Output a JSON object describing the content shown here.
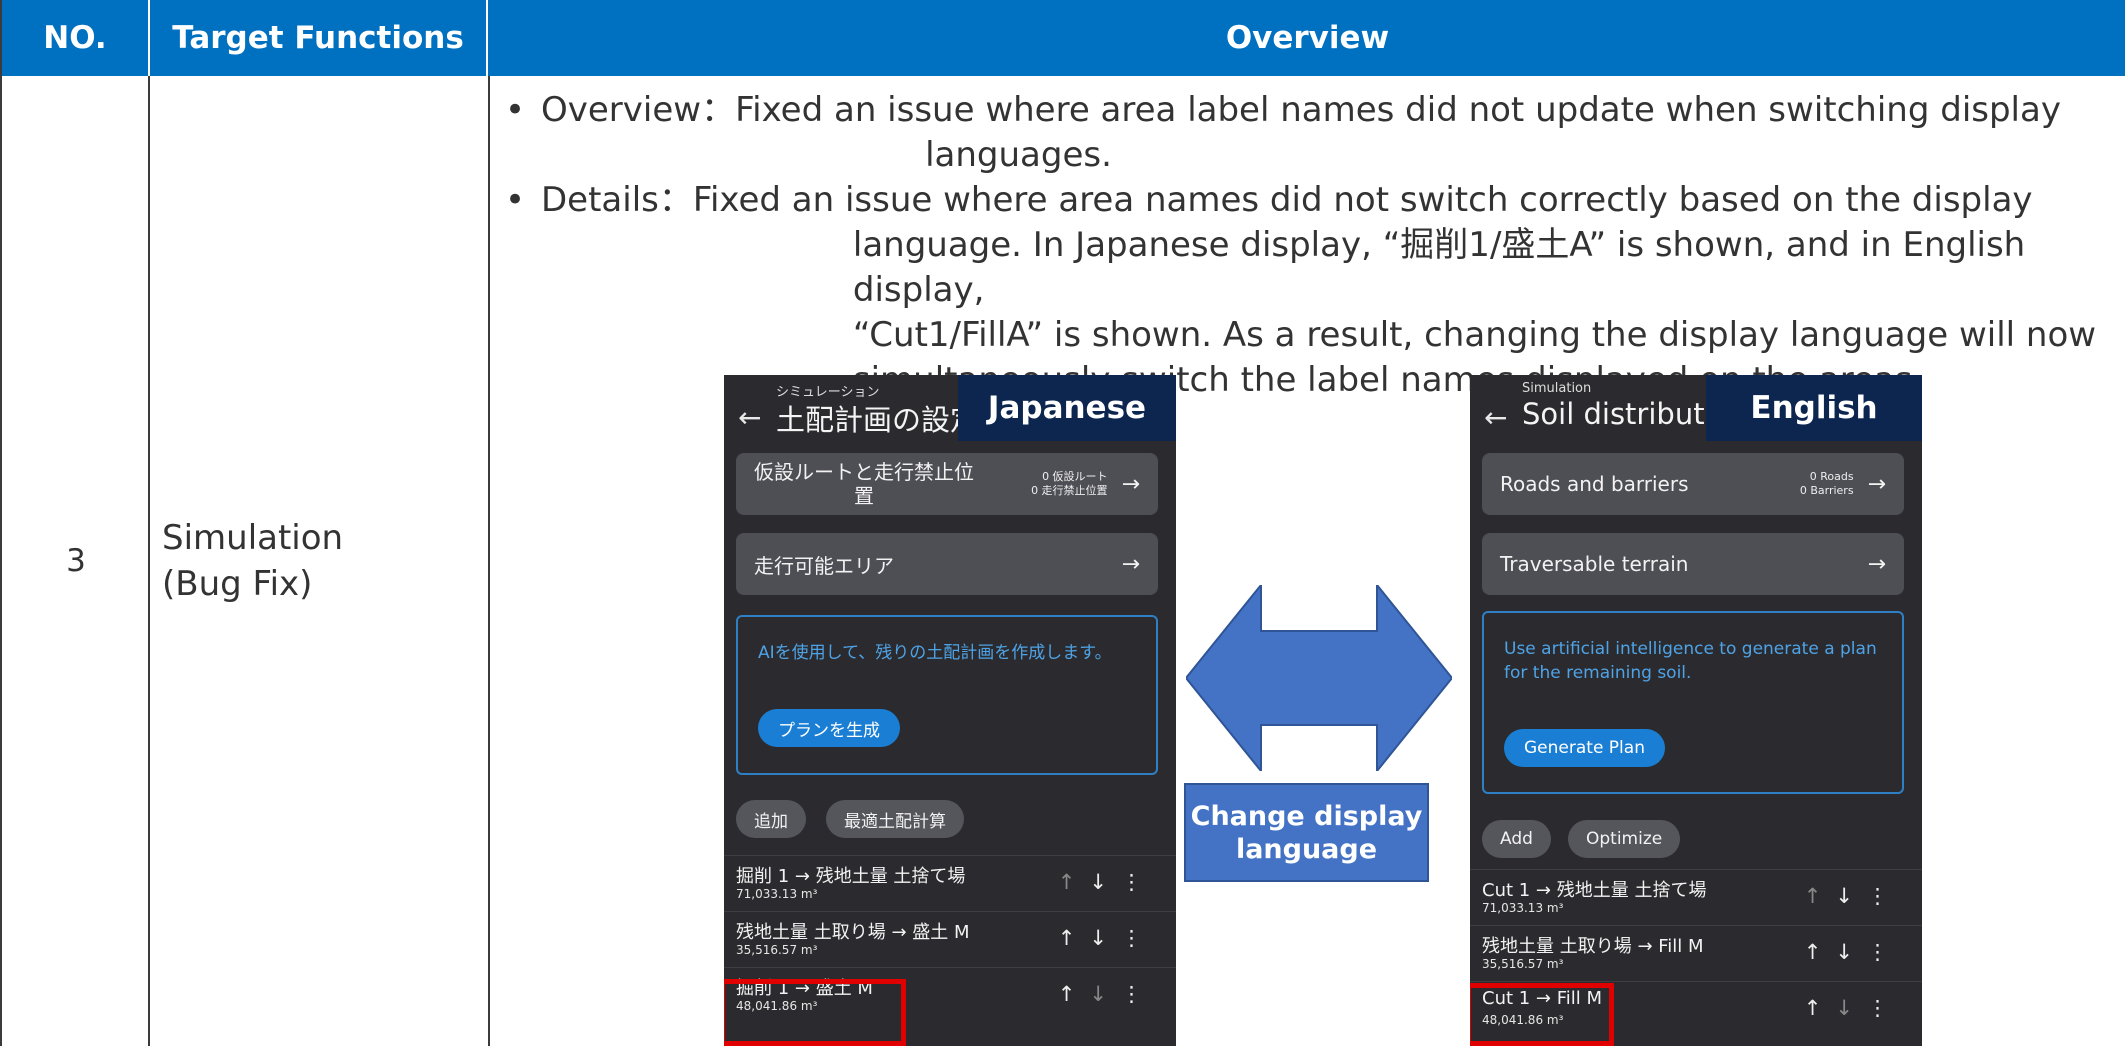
{
  "header": {
    "no": "NO.",
    "target_functions": "Target Functions",
    "overview": "Overview"
  },
  "row": {
    "no": "3",
    "target_function_line1": "Simulation",
    "target_function_line2": "(Bug Fix)",
    "bullet": "•",
    "overview_label": "Overview：",
    "overview_line1": "Fixed an issue where area label names did not update when switching display",
    "overview_line2": "languages.",
    "details_label": "Details：",
    "details_line1": "Fixed an issue where area names did not switch correctly based on the display",
    "details_line2": "language. In Japanese display, “掘削1/盛土A” is shown, and in English display,",
    "details_line3": "“Cut1/FillA” is shown. As a result, changing the display language will now",
    "details_line4": "simultaneously switch the label names displayed on the areas."
  },
  "change_label_line1": "Change display",
  "change_label_line2": "language",
  "phone_jp": {
    "badge": "Japanese",
    "back": "←",
    "subtitle": "シミュレーション",
    "title": "土配計画の設定",
    "card1_label_line1": "仮設ルートと走行禁止位",
    "card1_label_line2": "置",
    "card1_meta1": "0 仮設ルート",
    "card1_meta2": "0 走行禁止位置",
    "card2_label": "走行可能エリア",
    "arrow": "→",
    "ai_text": "AIを使用して、残りの土配計画を作成します。",
    "generate": "プランを生成",
    "chip_add": "追加",
    "chip_opt": "最適土配計算",
    "items": [
      {
        "main": "掘削 1 → 残地土量 土捨て場",
        "sub": "71,033.13 m³"
      },
      {
        "main": "残地土量 土取り場 → 盛土 M",
        "sub": "35,516.57 m³"
      },
      {
        "main": "掘削 1 → 盛土 M",
        "sub": "48,041.86 m³"
      }
    ],
    "up": "↑",
    "down": "↓",
    "more": "⋮"
  },
  "phone_en": {
    "badge": "English",
    "back": "←",
    "subtitle": "Simulation",
    "title": "Soil distributio",
    "card1_label": "Roads and barriers",
    "card1_meta1": "0 Roads",
    "card1_meta2": "0 Barriers",
    "card2_label": "Traversable terrain",
    "arrow": "→",
    "ai_text": "Use artificial intelligence to generate a plan for the remaining soil.",
    "generate": "Generate Plan",
    "chip_add": "Add",
    "chip_opt": "Optimize",
    "items": [
      {
        "main": "Cut 1 → 残地土量 土捨て場",
        "sub": "71,033.13 m³"
      },
      {
        "main": "残地土量 土取り場 → Fill M",
        "sub": "35,516.57 m³"
      },
      {
        "main": "Cut 1 → Fill M",
        "sub": "48,041.86 m³"
      }
    ],
    "up": "↑",
    "down": "↓",
    "more": "⋮"
  },
  "colors": {
    "header_bg": "#0070c0",
    "badge_bg": "#0d2650",
    "arrow_fill": "#4472c4",
    "highlight": "#e00000"
  }
}
